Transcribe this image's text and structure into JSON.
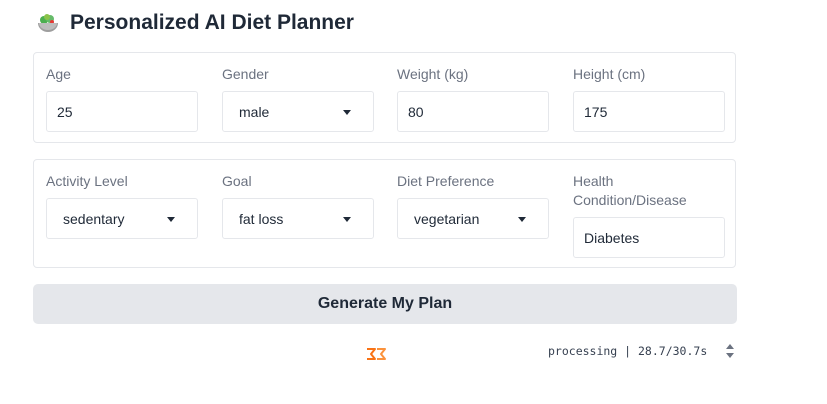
{
  "page": {
    "title": "Personalized AI Diet Planner",
    "title_icon": "salad-bowl-icon"
  },
  "fields": {
    "age": {
      "label": "Age",
      "value": "25"
    },
    "gender": {
      "label": "Gender",
      "value": "male"
    },
    "weight": {
      "label": "Weight (kg)",
      "value": "80"
    },
    "height": {
      "label": "Height (cm)",
      "value": "175"
    },
    "activity": {
      "label": "Activity Level",
      "value": "sedentary"
    },
    "goal": {
      "label": "Goal",
      "value": "fat loss"
    },
    "diet": {
      "label": "Diet Preference",
      "value": "vegetarian"
    },
    "health": {
      "label": "Health Condition/Disease",
      "value": "Diabetes"
    }
  },
  "generate_button": {
    "label": "Generate My Plan"
  },
  "status": {
    "text": "processing | 28.7/30.7s",
    "elapsed_seconds": 28.7,
    "estimated_seconds": 30.7
  },
  "colors": {
    "accent": "#f97316",
    "button_bg": "#e5e7eb",
    "border": "#e5e7eb",
    "label": "#6b7280"
  }
}
